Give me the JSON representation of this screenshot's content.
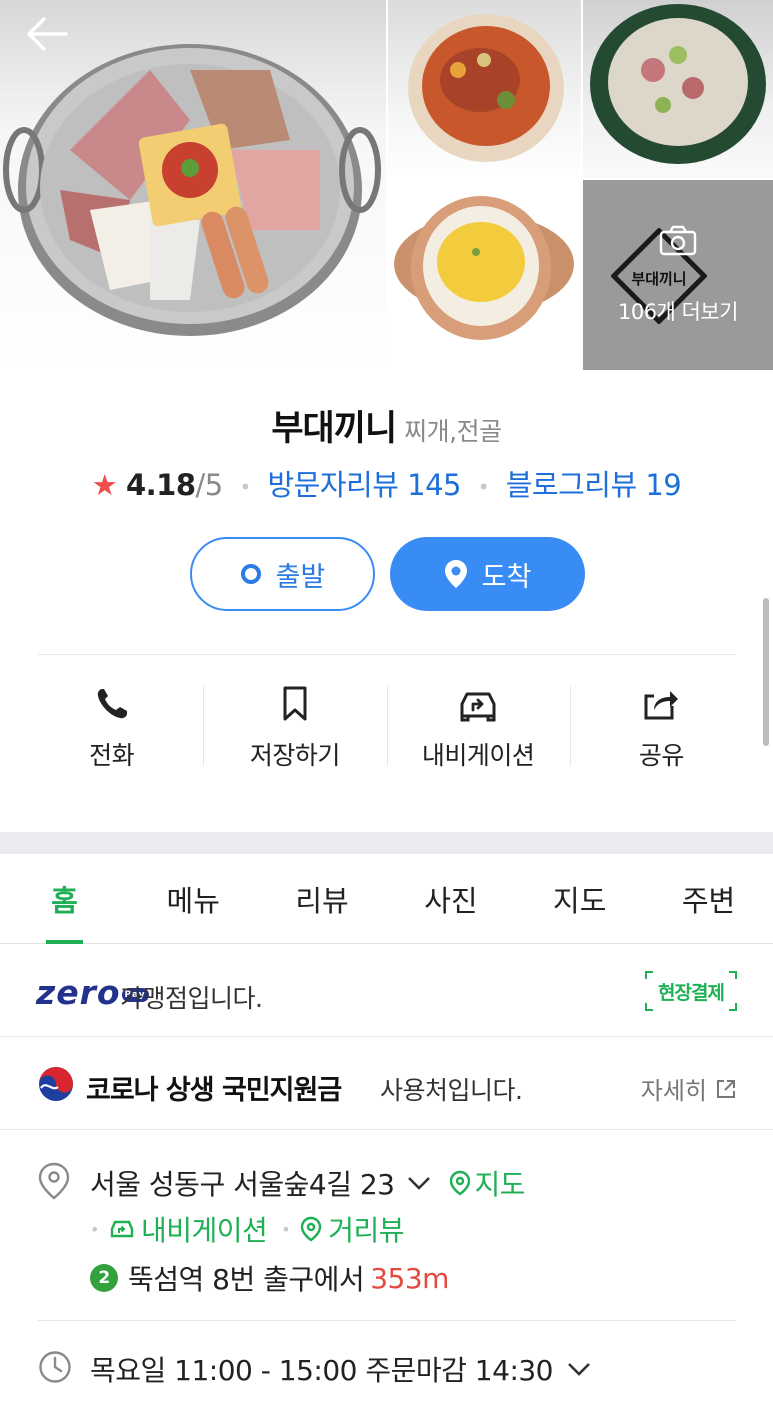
{
  "gallery": {
    "more_label": "106개 더보기",
    "logo_text": "부대끼니"
  },
  "place": {
    "name": "부대끼니",
    "category": "찌개,전골",
    "rating": "4.18",
    "rating_max": "/5",
    "visitor_reviews": "방문자리뷰 145",
    "blog_reviews": "블로그리뷰 19"
  },
  "route": {
    "depart_label": "출발",
    "arrive_label": "도착"
  },
  "actions": [
    {
      "label": "전화",
      "icon": "phone-icon"
    },
    {
      "label": "저장하기",
      "icon": "bookmark-icon"
    },
    {
      "label": "내비게이션",
      "icon": "car-navigation-icon"
    },
    {
      "label": "공유",
      "icon": "share-icon"
    }
  ],
  "tabs": [
    {
      "label": "홈",
      "active": true
    },
    {
      "label": "메뉴"
    },
    {
      "label": "리뷰"
    },
    {
      "label": "사진"
    },
    {
      "label": "지도"
    },
    {
      "label": "주변"
    }
  ],
  "zeropay": {
    "logo": "zero",
    "badge": "Pay",
    "text": "가맹점입니다.",
    "onsite_label": "현장결제"
  },
  "covid": {
    "title": "코로나 상생 국민지원금",
    "suffix": "사용처입니다.",
    "detail_label": "자세히"
  },
  "location": {
    "address": "서울 성동구 서울숲4길 23",
    "map_label": "지도",
    "navigation_label": "내비게이션",
    "streetview_label": "거리뷰",
    "subway_line": "2",
    "subway_text": "뚝섬역 8번 출구에서",
    "subway_distance": "353m"
  },
  "hours": {
    "text": "목요일 11:00 - 15:00 주문마감 14:30"
  },
  "colors": {
    "accent_green": "#1fb055",
    "accent_blue": "#3a8cf5",
    "star_red": "#f04d4d",
    "distance_red": "#e44a40",
    "line2_green": "#33a23d",
    "zeropay_navy": "#23328c"
  }
}
